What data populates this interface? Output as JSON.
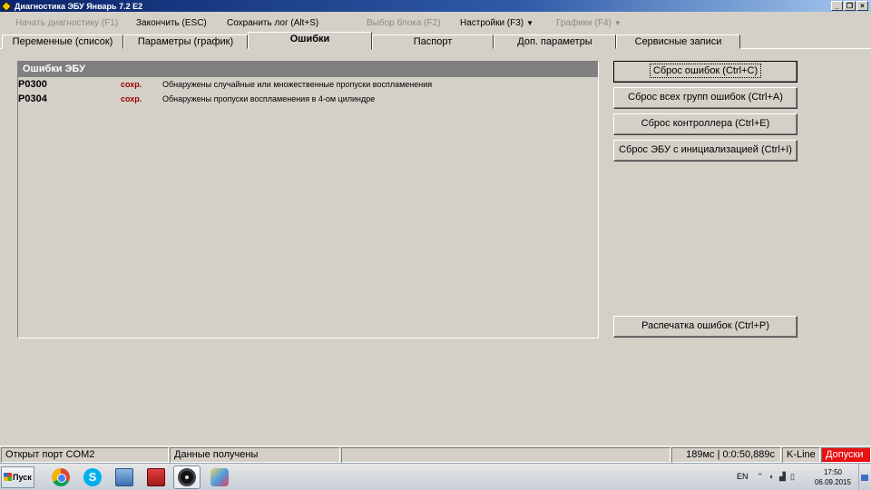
{
  "window": {
    "title": "Диагностика ЭБУ Январь 7.2 Е2",
    "min_glyph": "_",
    "restore_glyph": "❐",
    "close_glyph": "×"
  },
  "menu": {
    "start_diag": "Начать диагностику (F1)",
    "finish": "Закончить (ESC)",
    "save_log": "Сохранить лог (Alt+S)",
    "select_block": "Выбор блока (F2)",
    "settings": "Настройки (F3)",
    "graphs": "Графики (F4)"
  },
  "tabs": {
    "variables": "Переменные (список)",
    "params": "Параметры (график)",
    "errors": "Ошибки",
    "passport": "Паспорт",
    "extra_params": "Доп. параметры",
    "service": "Сервисные записи"
  },
  "errors_panel": {
    "title": "Ошибки ЭБУ",
    "rows": [
      {
        "code": "P0300",
        "status": "сохр.",
        "description": "Обнаружены случайные или множественные пропуски воспламенения"
      },
      {
        "code": "P0304",
        "status": "сохр.",
        "description": "Обнаружены пропуски воспламенения в 4-ом цилиндре"
      }
    ]
  },
  "buttons": {
    "reset_errors": "Сброс ошибок (Ctrl+C)",
    "reset_all_groups": "Сброс всех групп ошибок (Ctrl+A)",
    "reset_controller": "Сброс контроллера (Ctrl+E)",
    "reset_ecu_init": "Сброс ЭБУ с инициализацией (Ctrl+I)",
    "print_errors": "Распечатка ошибок (Ctrl+P)"
  },
  "status": {
    "port": "Открыт порт COM2",
    "data": "Данные получены",
    "timing": "189мс | 0:0:50,889с",
    "interface": "K-Line",
    "tolerance": "Допуски"
  },
  "taskbar": {
    "start_label": "Пуск",
    "lang": "EN",
    "time": "17:50",
    "date": "06.09.2015",
    "apps": [
      "chrome-icon",
      "skype-icon",
      "remote-desktop-icon",
      "toolbox-icon",
      "steering-wheel-icon",
      "paint-icon"
    ]
  }
}
